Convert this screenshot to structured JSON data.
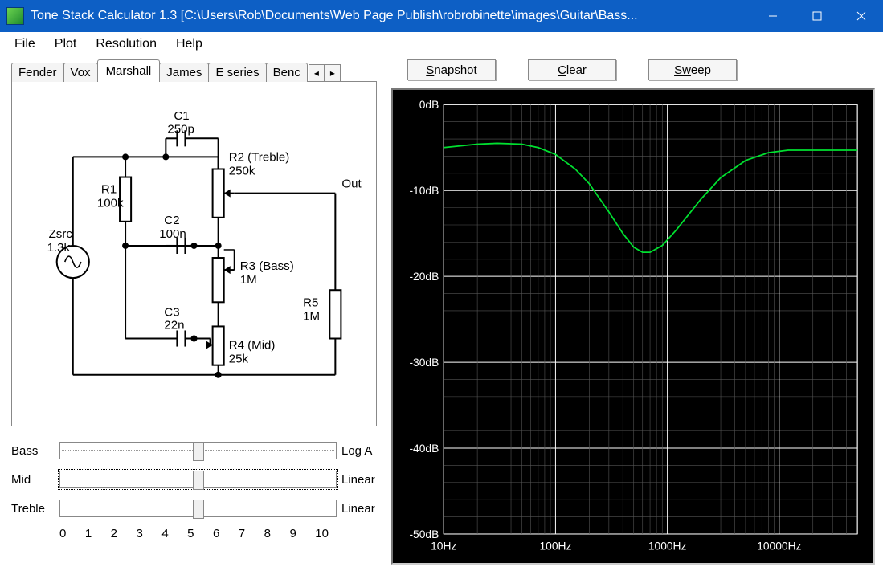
{
  "window": {
    "title": "Tone Stack Calculator 1.3 [C:\\Users\\Rob\\Documents\\Web Page Publish\\robrobinette\\images\\Guitar\\Bass..."
  },
  "menu": {
    "items": [
      "File",
      "Plot",
      "Resolution",
      "Help"
    ]
  },
  "tabs": {
    "items": [
      "Fender",
      "Vox",
      "Marshall",
      "James",
      "E series",
      "Benc"
    ],
    "active_index": 2
  },
  "schematic": {
    "zsrc_label": "Zsrc",
    "zsrc_value": "1.3k",
    "r1_label": "R1",
    "r1_value": "100k",
    "c1_label": "C1",
    "c1_value": "250p",
    "c2_label": "C2",
    "c2_value": "100n",
    "c3_label": "C3",
    "c3_value": "22n",
    "r2_label": "R2 (Treble)",
    "r2_value": "250k",
    "r3_label": "R3 (Bass)",
    "r3_value": "1M",
    "r4_label": "R4 (Mid)",
    "r4_value": "25k",
    "r5_label": "R5",
    "r5_value": "1M",
    "out_label": "Out"
  },
  "sliders": {
    "rows": [
      {
        "label": "Bass",
        "law": "Log A",
        "pos": 0.5
      },
      {
        "label": "Mid",
        "law": "Linear",
        "pos": 0.5
      },
      {
        "label": "Treble",
        "law": "Linear",
        "pos": 0.5
      }
    ],
    "ticks": [
      "0",
      "1",
      "2",
      "3",
      "4",
      "5",
      "6",
      "7",
      "8",
      "9",
      "10"
    ]
  },
  "buttons": {
    "snapshot": "napshot",
    "snapshot_ul": "S",
    "clear": "lear",
    "clear_ul": "C",
    "sweep": "eep",
    "sweep_ul": "Sw"
  },
  "chart_data": {
    "type": "line",
    "xlabel": "",
    "ylabel": "",
    "x_scale": "log",
    "xlim_hz": [
      10,
      50000
    ],
    "ylim_db": [
      -50,
      0
    ],
    "y_ticks_db": [
      0,
      -10,
      -20,
      -30,
      -40,
      -50
    ],
    "x_ticks_hz": [
      10,
      100,
      1000,
      10000
    ],
    "x_tick_labels": [
      "10Hz",
      "100Hz",
      "1000Hz",
      "10000Hz"
    ],
    "y_tick_labels": [
      "0dB",
      "-10dB",
      "-20dB",
      "-30dB",
      "-40dB",
      "-50dB"
    ],
    "series": [
      {
        "name": "response",
        "color": "#00e030",
        "points_hz_db": [
          [
            10,
            -5.0
          ],
          [
            20,
            -4.6
          ],
          [
            30,
            -4.5
          ],
          [
            50,
            -4.6
          ],
          [
            70,
            -5.0
          ],
          [
            100,
            -5.8
          ],
          [
            150,
            -7.5
          ],
          [
            200,
            -9.2
          ],
          [
            300,
            -12.5
          ],
          [
            400,
            -15.0
          ],
          [
            500,
            -16.6
          ],
          [
            600,
            -17.2
          ],
          [
            700,
            -17.2
          ],
          [
            900,
            -16.4
          ],
          [
            1200,
            -14.6
          ],
          [
            2000,
            -11.0
          ],
          [
            3000,
            -8.5
          ],
          [
            5000,
            -6.5
          ],
          [
            8000,
            -5.6
          ],
          [
            12000,
            -5.3
          ],
          [
            20000,
            -5.3
          ],
          [
            50000,
            -5.3
          ]
        ]
      }
    ]
  }
}
